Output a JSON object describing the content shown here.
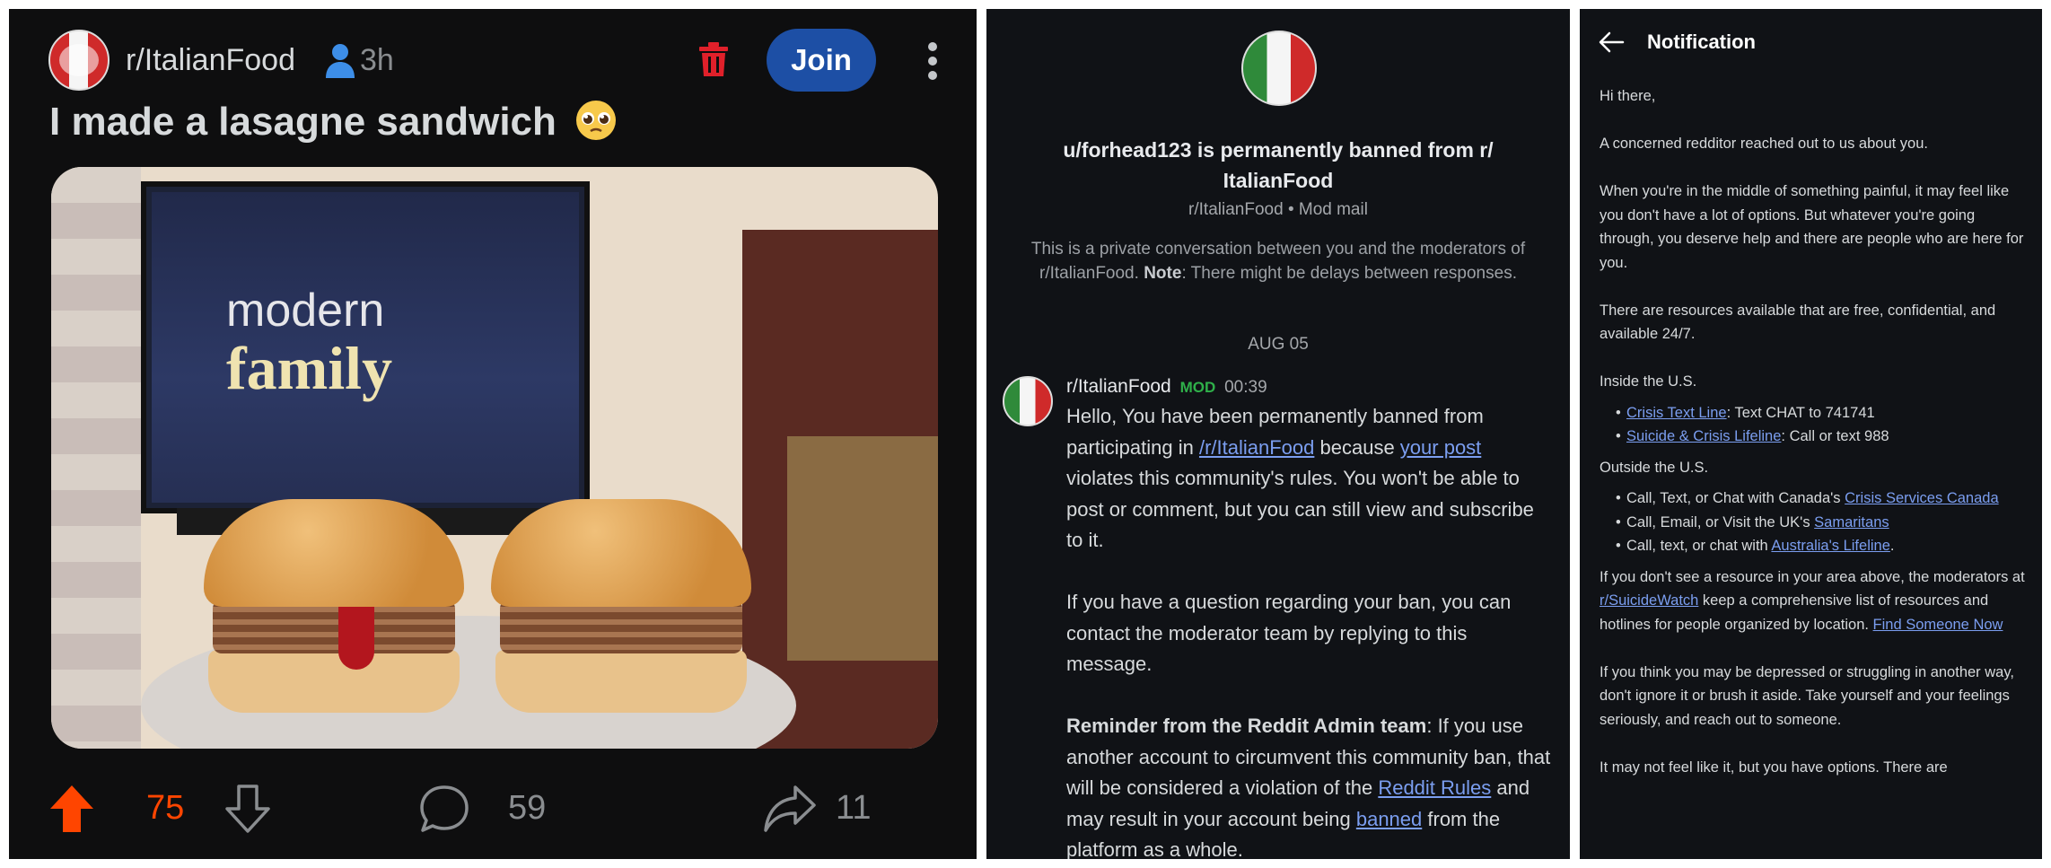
{
  "post": {
    "subreddit": "r/ItalianFood",
    "age": "3h",
    "join_label": "Join",
    "title": "I made a lasagne sandwich",
    "image": {
      "tv_line1": "modern",
      "tv_line2": "family"
    },
    "votes": "75",
    "comments": "59",
    "shares": "11",
    "colors": {
      "upvote": "#ff4500",
      "join": "#1d4fa5",
      "trash": "#e0202a"
    }
  },
  "modmail": {
    "title": "u/forhead123 is permanently banned from r/ ItalianFood",
    "subtitle": "r/ItalianFood • Mod mail",
    "private_a": "This is a private conversation between you and the moderators of r/ItalianFood.",
    "private_note": "Note",
    "private_b": ": There might be delays between responses.",
    "date": "AUG 05",
    "sender": "r/ItalianFood",
    "mod_badge": "MOD",
    "time": "00:39",
    "p1_a": "Hello, You have been permanently banned from participating in ",
    "p1_link1": "/r/ItalianFood",
    "p1_b": " because ",
    "p1_link2": "your post",
    "p1_c": " violates this community's rules. You won't be able to post or comment, but you can still view and subscribe to it.",
    "p2": "If you have a question regarding your ban, you can contact the moderator team by replying to this message.",
    "p3_bold": "Reminder from the Reddit Admin team",
    "p3_a": ": If you use another account to circumvent this community ban, that will be considered a violation of the ",
    "p3_link1": "Reddit Rules",
    "p3_b": " and may result in your account being ",
    "p3_link2": "banned",
    "p3_c": " from the platform as a whole."
  },
  "notification": {
    "title": "Notification",
    "greeting": "Hi there,",
    "p1": "A concerned redditor reached out to us about you.",
    "p2": "When you're in the middle of something painful, it may feel like you don't have a lot of options. But whatever you're going through, you deserve help and there are people who are here for you.",
    "p3": "There are resources available that are free, confidential, and available 24/7.",
    "inside_heading": "Inside the U.S.",
    "inside": [
      {
        "link": "Crisis Text Line",
        "text": ": Text CHAT to 741741"
      },
      {
        "link": "Suicide & Crisis Lifeline",
        "text": ": Call or text 988"
      }
    ],
    "outside_heading": "Outside the U.S.",
    "outside": [
      {
        "pre": "Call, Text, or Chat with Canada's ",
        "link": "Crisis Services Canada",
        "post": ""
      },
      {
        "pre": "Call, Email, or Visit the UK's ",
        "link": "Samaritans",
        "post": ""
      },
      {
        "pre": "Call, text, or chat with ",
        "link": "Australia's Lifeline",
        "post": "."
      }
    ],
    "p4_a": "If you don't see a resource in your area above, the moderators at ",
    "p4_link1": "r/SuicideWatch",
    "p4_b": " keep a comprehensive list of resources and hotlines for people organized by location. ",
    "p4_link2": "Find Someone Now",
    "p5": "If you think you may be depressed or struggling in another way, don't ignore it or brush it aside. Take yourself and your feelings seriously, and reach out to someone.",
    "p6": "It may not feel like it, but you have options. There are"
  }
}
